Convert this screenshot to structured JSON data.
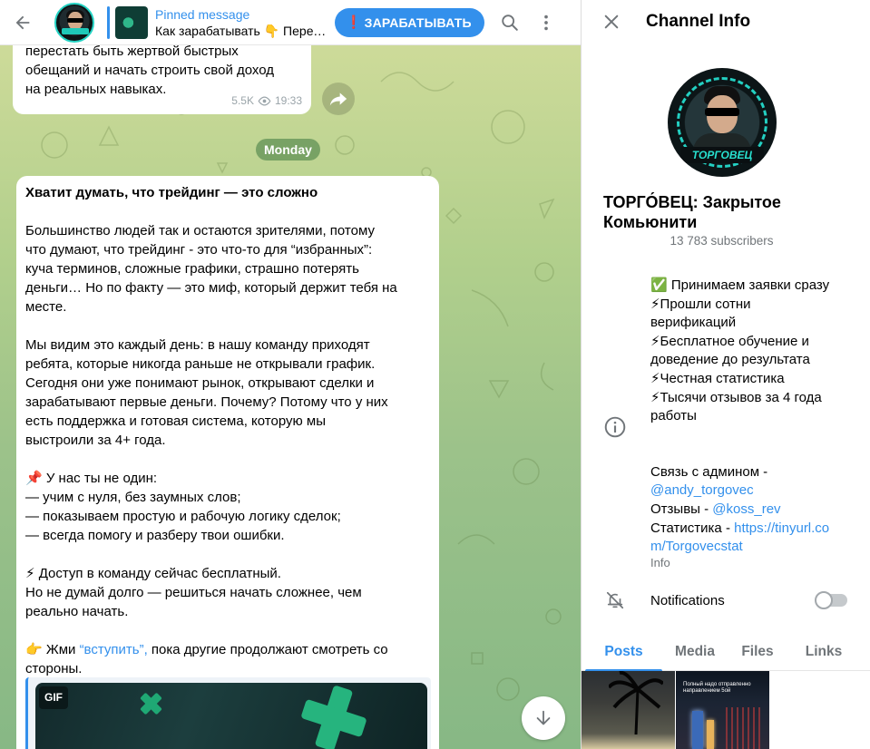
{
  "chat": {
    "pinned": {
      "title": "Pinned message",
      "body": "Как зарабатывать 👇 Перед…"
    },
    "earn_button": {
      "mark": "❗",
      "label": "ЗАРАБАТЫВАТЬ"
    },
    "prev_message": {
      "lines": [
        "перестать быть жертвой быстрых",
        "обещаний и начать строить свой доход",
        "на реальных навыках."
      ],
      "views": "5.5K",
      "time": "19:33"
    },
    "day_label": "Monday",
    "post": {
      "title": "Хватит думать, что трейдинг — это сложно",
      "para1": [
        "Большинство людей так и остаются зрителями, потому",
        "что думают, что трейдинг - это что-то для “избранных”:",
        "куча терминов, сложные графики, страшно потерять",
        "деньги… Но по факту — это миф, который держит тебя на",
        "месте."
      ],
      "para2": [
        "Мы видим это каждый день: в нашу команду приходят",
        "ребята, которые никогда раньше не открывали график.",
        "Сегодня они уже понимают рынок, открывают сделки и",
        "зарабатывают первые деньги. Почему? Потому что у них",
        "есть поддержка и готовая система, которую мы",
        "выстроили за 4+ года."
      ],
      "para3": [
        "📌 У нас ты не один:",
        "— учим с нуля, без заумных слов;",
        "— показываем простую и рабочую логику сделок;",
        "— всегда помогу и разберу твои ошибки."
      ],
      "para4": [
        "⚡ Доступ в команду сейчас бесплатный.",
        "Но не думай долго — решиться начать сложнее, чем",
        "реально начать."
      ],
      "cta_prefix": "👉 Жми ",
      "cta_link": "“вступить”,",
      "cta_suffix": " пока другие продолжают смотреть со",
      "cta_line2": "стороны.",
      "gif_label": "GIF"
    }
  },
  "info": {
    "header_title": "Channel Info",
    "channel_name": "ТОРГО́ВЕЦ: Закрытое Комьюнити",
    "avatar_logo": "ТОРГОВЕЦ",
    "subscribers": "13 783 subscribers",
    "description": [
      "✅ Принимаем заявки сразу",
      "⚡Прошли сотни",
      "верификаций",
      "⚡Бесплатное обучение и",
      "доведение до результата",
      "⚡Честная статистика",
      "⚡Тысячи отзывов за 4 года",
      "работы"
    ],
    "contact": {
      "admin_label": "Связь с админом -",
      "admin_link": "@andy_torgovec",
      "reviews_label": "Отзывы - ",
      "reviews_link": "@koss_rev",
      "stats_label": "Статистика - ",
      "stats_link1": "https://tinyurl.co",
      "stats_link2": "m/Torgovecstat"
    },
    "desc_label": "Info",
    "notifications_label": "Notifications",
    "notifications_on": false,
    "tabs": [
      "Posts",
      "Media",
      "Files",
      "Links"
    ],
    "active_tab": "Posts",
    "thumb2_caption": "Полный надо отправленно направлением 5ой"
  },
  "colors": {
    "accent": "#3390ec",
    "chat_bg_top": "#d3dd9c",
    "chat_bg_bottom": "#87b885",
    "day_pill": "#4c8248",
    "secondary_text": "#707579"
  },
  "icons": [
    "back-arrow-icon",
    "search-icon",
    "more-vertical-icon",
    "eye-icon",
    "share-icon",
    "arrow-down-icon",
    "close-icon",
    "info-icon",
    "bell-off-icon"
  ]
}
